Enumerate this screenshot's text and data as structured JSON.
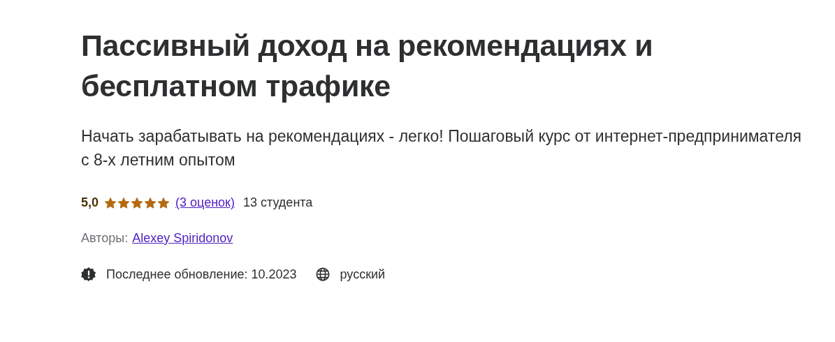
{
  "title": "Пассивный доход на рекомендациях и бесплатном трафике",
  "subtitle": "Начать зарабатывать на рекомендациях - легко! Пошаговый курс от интернет-предпринимателя с 8-х летним опытом",
  "rating": {
    "score": "5,0",
    "stars": 5,
    "reviews": "(3 оценок)",
    "students": "13 студента"
  },
  "authors": {
    "label": "Авторы:",
    "name": "Alexey Spiridonov"
  },
  "meta": [
    {
      "kind": "updated",
      "text": "Последнее обновление: 10.2023"
    },
    {
      "kind": "language",
      "text": "русский"
    }
  ]
}
